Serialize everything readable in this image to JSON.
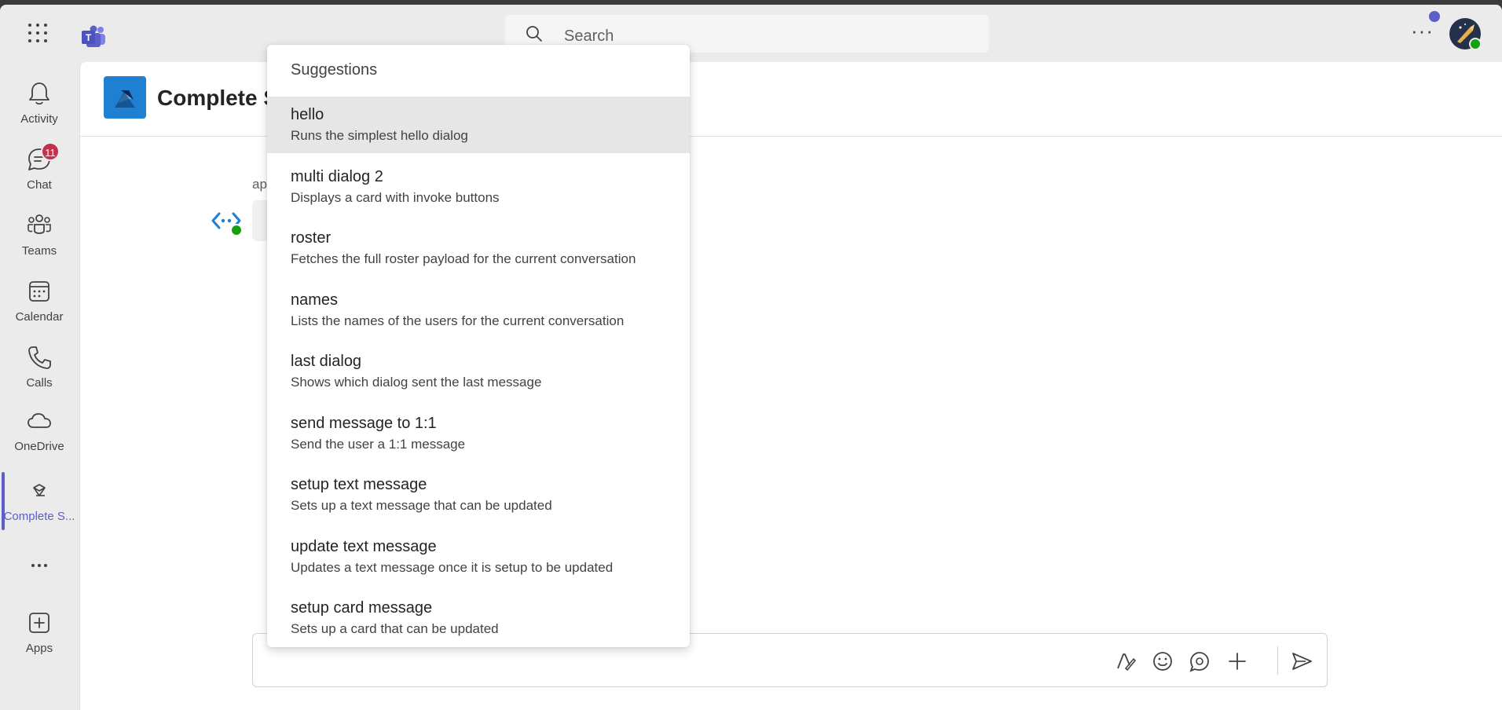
{
  "topbar": {
    "search_placeholder": "Search"
  },
  "rail": {
    "items": [
      {
        "label": "Activity",
        "icon": "bell-icon"
      },
      {
        "label": "Chat",
        "icon": "chat-icon",
        "badge": "11"
      },
      {
        "label": "Teams",
        "icon": "teams-icon"
      },
      {
        "label": "Calendar",
        "icon": "calendar-icon"
      },
      {
        "label": "Calls",
        "icon": "phone-icon"
      },
      {
        "label": "OneDrive",
        "icon": "cloud-icon"
      },
      {
        "label": "Complete S...",
        "icon": "app-icon",
        "active": true
      },
      {
        "label": "",
        "icon": "more-icon"
      },
      {
        "label": "Apps",
        "icon": "add-app-icon"
      }
    ]
  },
  "main": {
    "title": "Complete S",
    "sender_prefix": "ap"
  },
  "suggestions": {
    "header": "Suggestions",
    "items": [
      {
        "title": "hello",
        "desc": "Runs the simplest hello dialog",
        "selected": true
      },
      {
        "title": "multi dialog 2",
        "desc": "Displays a card with invoke buttons"
      },
      {
        "title": "roster",
        "desc": "Fetches the full roster payload for the current conversation"
      },
      {
        "title": "names",
        "desc": "Lists the names of the users for the current conversation"
      },
      {
        "title": "last dialog",
        "desc": "Shows which dialog sent the last message"
      },
      {
        "title": "send message to 1:1",
        "desc": "Send the user a 1:1 message"
      },
      {
        "title": "setup text message",
        "desc": "Sets up a text message that can be updated"
      },
      {
        "title": "update text message",
        "desc": "Updates a text message once it is setup to be updated"
      },
      {
        "title": "setup card message",
        "desc": "Sets up a card that can be updated"
      }
    ]
  },
  "colors": {
    "accent": "#5b5fc7",
    "badge": "#c4314b",
    "status_available": "#13a10e"
  }
}
